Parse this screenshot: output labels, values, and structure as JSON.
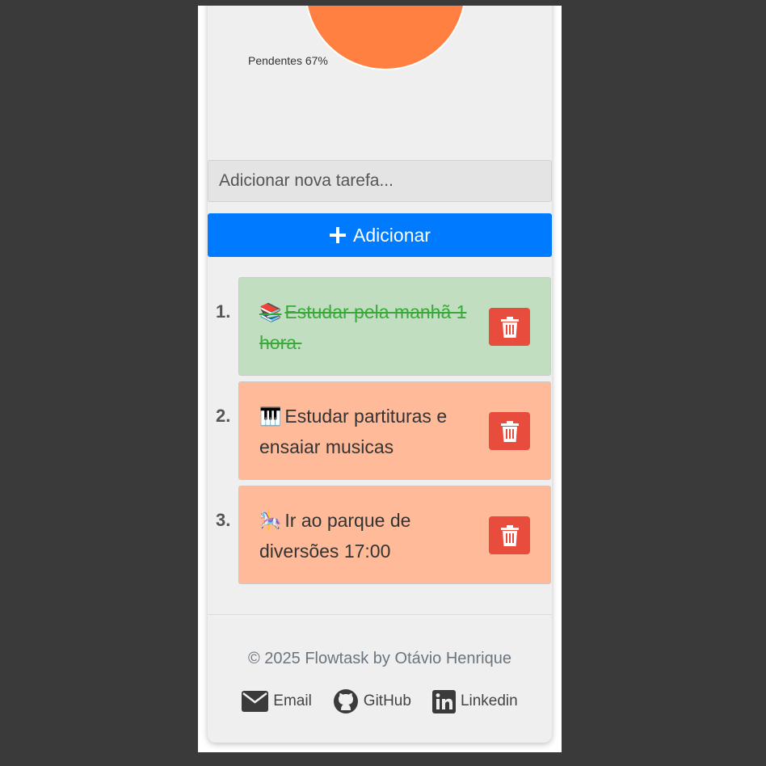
{
  "chart": {
    "pending_label": "Pendentes 67%",
    "pending_color": "#ff8c42"
  },
  "chart_data": {
    "type": "pie",
    "slices": [
      {
        "name": "Pendentes",
        "value": 67,
        "color": "#ff8c42"
      }
    ]
  },
  "form": {
    "input_placeholder": "Adicionar nova tarefa...",
    "add_label": "Adicionar",
    "add_color": "#007bff"
  },
  "tasks": [
    {
      "number": "1.",
      "emoji": "📚",
      "text": "Estudar pela manhã 1 hora.",
      "done": true
    },
    {
      "number": "2.",
      "emoji": "🎹",
      "text": "Estudar partituras e ensaiar musicas",
      "done": false
    },
    {
      "number": "3.",
      "emoji": "🎠",
      "text": "Ir ao parque de diversões 17:00",
      "done": false
    }
  ],
  "footer": {
    "copyright": "© 2025 Flowtask by Otávio Henrique",
    "links": [
      {
        "label": "Email",
        "icon": "envelope-icon"
      },
      {
        "label": "GitHub",
        "icon": "github-icon"
      },
      {
        "label": "Linkedin",
        "icon": "linkedin-icon"
      }
    ]
  }
}
